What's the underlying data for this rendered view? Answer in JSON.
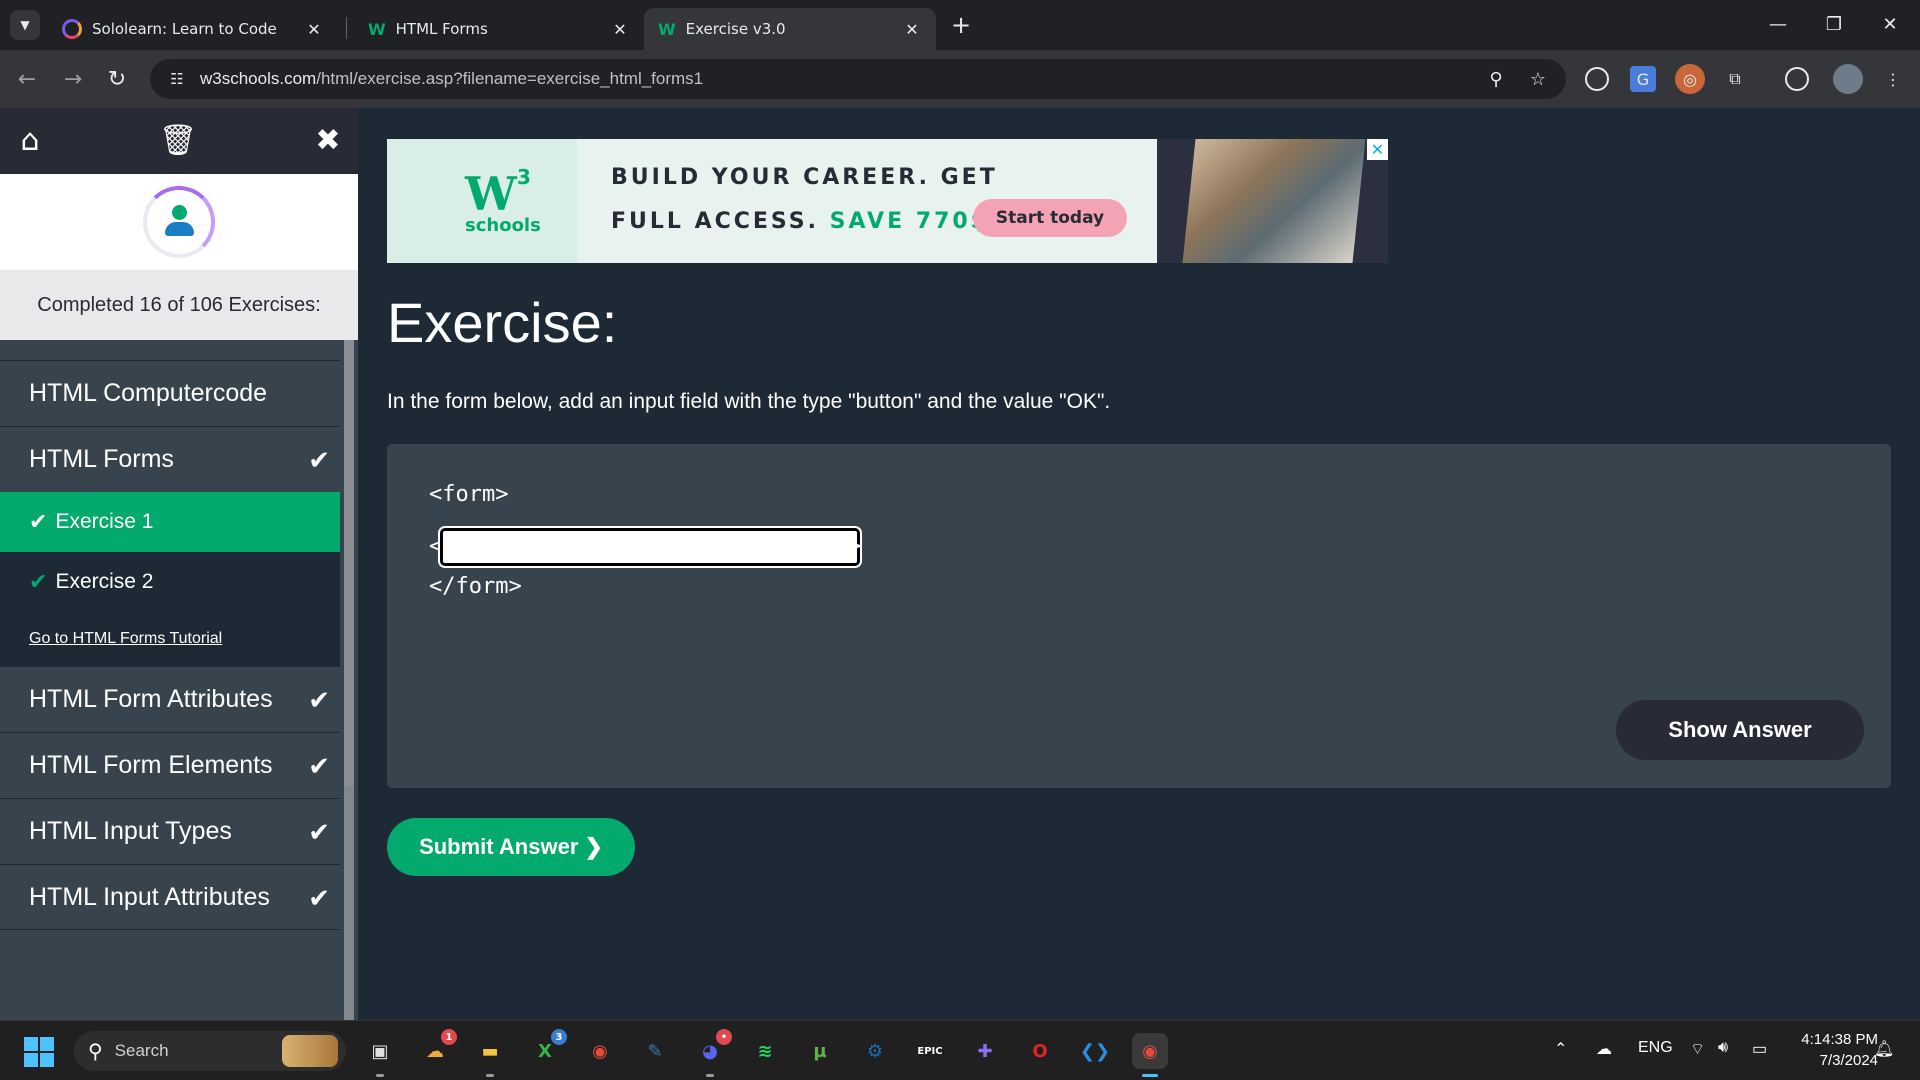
{
  "browser": {
    "tabs": [
      {
        "label": "Sololearn: Learn to Code",
        "icon": "sololearn-icon",
        "active": false
      },
      {
        "label": "HTML Forms",
        "icon": "w3schools-icon",
        "active": false
      },
      {
        "label": "Exercise v3.0",
        "icon": "w3schools-icon",
        "active": true
      }
    ],
    "url_domain": "w3schools.com",
    "url_path": "/html/exercise.asp?filename=exercise_html_forms1"
  },
  "sidebar": {
    "completed_text": "Completed 16 of 106 Exercises:",
    "items": [
      {
        "label": "HTML Computercode",
        "checked": false
      },
      {
        "label": "HTML Forms",
        "checked": true
      },
      {
        "label": "HTML Form Attributes",
        "checked": true
      },
      {
        "label": "HTML Form Elements",
        "checked": true
      },
      {
        "label": "HTML Input Types",
        "checked": true
      },
      {
        "label": "HTML Input Attributes",
        "checked": true
      }
    ],
    "sub_items": [
      {
        "label": "Exercise 1",
        "active": true
      },
      {
        "label": "Exercise 2",
        "active": false
      }
    ],
    "tutorial_link": "Go to HTML Forms Tutorial"
  },
  "ad": {
    "logo_mark": "W",
    "logo_sup": "3",
    "logo_text": "schools",
    "line1": "BUILD YOUR CAREER. GET",
    "line2_prefix": "FULL ACCESS.",
    "line2_highlight": "SAVE 770$",
    "cta": "Start today",
    "close": "✕"
  },
  "exercise": {
    "title": "Exercise:",
    "instruction": "In the form below, add an input field with the type \"button\" and the value \"OK\".",
    "code_open": "<form>",
    "code_close": "</form>",
    "input_value": "",
    "show_answer": "Show Answer",
    "submit": "Submit Answer ❯"
  },
  "taskbar": {
    "search_label": "Search",
    "apps": [
      {
        "name": "task-view",
        "glyph": "▣",
        "color": "#e0e0e0",
        "badge": ""
      },
      {
        "name": "weather",
        "glyph": "☁",
        "color": "#f2a93b",
        "badge": "1"
      },
      {
        "name": "file-explorer",
        "glyph": "▬",
        "color": "#f6c443",
        "badge": ""
      },
      {
        "name": "xbox",
        "glyph": "X",
        "color": "#36b34a",
        "badge": "3"
      },
      {
        "name": "chrome",
        "glyph": "◉",
        "color": "#e64a3b",
        "badge": ""
      },
      {
        "name": "python",
        "glyph": "✎",
        "color": "#3b78b3",
        "badge": ""
      },
      {
        "name": "discord",
        "glyph": "◕",
        "color": "#5865f2",
        "badge": "•"
      },
      {
        "name": "spotify",
        "glyph": "≋",
        "color": "#1ed760",
        "badge": ""
      },
      {
        "name": "utorrent",
        "glyph": "µ",
        "color": "#5fb248",
        "badge": ""
      },
      {
        "name": "steam",
        "glyph": "⚙",
        "color": "#1b6fb6",
        "badge": ""
      },
      {
        "name": "epic-games",
        "glyph": "EPIC",
        "color": "#2a2a2a",
        "badge": ""
      },
      {
        "name": "game-controller",
        "glyph": "✚",
        "color": "#8a6df1",
        "badge": ""
      },
      {
        "name": "opera",
        "glyph": "O",
        "color": "#e0222d",
        "badge": ""
      },
      {
        "name": "vscode",
        "glyph": "❮❯",
        "color": "#2a8ee6",
        "badge": ""
      },
      {
        "name": "chrome-active",
        "glyph": "◉",
        "color": "#e64a3b",
        "badge": ""
      }
    ],
    "tray_lang": "ENG",
    "time": "4:14:38 PM",
    "date": "7/3/2024"
  }
}
